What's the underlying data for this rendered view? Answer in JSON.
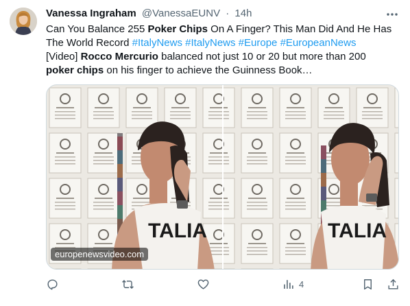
{
  "tweet": {
    "author_name": "Vanessa Ingraham",
    "handle": "@VanessaEUNV",
    "separator": "·",
    "time": "14h",
    "text": {
      "l1_a": "Can You Balance 255 ",
      "l1_b": "Poker Chips",
      "l1_c": " On A Finger? This Man Did And He Has",
      "l2_a": "The World Record ",
      "l2_tags": [
        "#ItalyNews",
        "#ItalyNews",
        "#Europe",
        "#EuropeanNews"
      ],
      "l3_a": "[Video] ",
      "l3_b": "Rocco Mercurio",
      "l3_c": " balanced not just 10 or 20 but more than 200",
      "l4_b": "poker chips",
      "l4_c": " on his finger to achieve the Guinness Book…"
    },
    "media": {
      "watermark": "europenewsvideo.com",
      "shirt_text": "TALIA"
    },
    "actions": {
      "reply": {
        "icon": "reply-icon"
      },
      "retweet": {
        "icon": "retweet-icon"
      },
      "like": {
        "icon": "like-icon"
      },
      "views": {
        "icon": "views-icon",
        "count": "4"
      },
      "bookmark": {
        "icon": "bookmark-icon"
      },
      "share": {
        "icon": "share-icon"
      }
    },
    "colors": {
      "link": "#1d9bf0",
      "secondary_text": "#536471",
      "primary_text": "#0f1419",
      "divider": "#cfd9de"
    }
  }
}
